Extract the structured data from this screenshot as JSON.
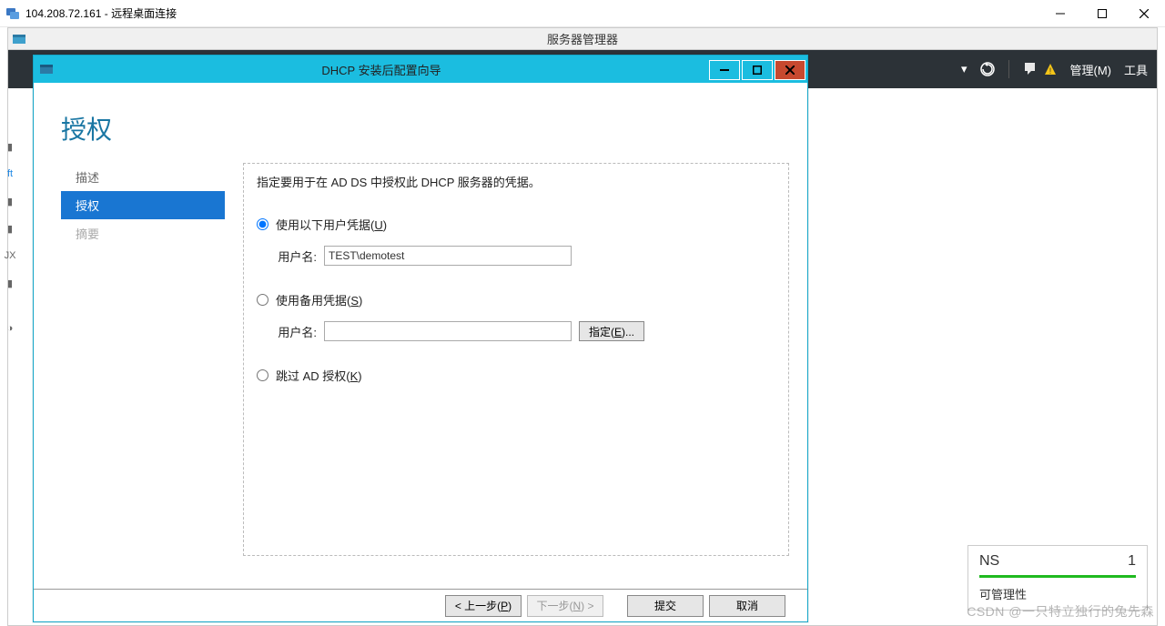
{
  "rdp": {
    "title": "104.208.72.161 - 远程桌面连接"
  },
  "server_manager": {
    "title": "服务器管理器",
    "toolbar": {
      "manage": "管理(M)",
      "tools": "工具"
    },
    "card": {
      "label": "NS",
      "count": "1",
      "manageability": "可管理性"
    }
  },
  "wizard": {
    "title": "DHCP 安装后配置向导",
    "heading": "授权",
    "nav": {
      "description": "描述",
      "authorize": "授权",
      "summary": "摘要"
    },
    "desc": "指定要用于在 AD DS 中授权此 DHCP 服务器的凭据。",
    "opt1": {
      "label": "使用以下用户凭据(U)",
      "username_label": "用户名:",
      "username_value": "TEST\\demotest"
    },
    "opt2": {
      "label": "使用备用凭据(S)",
      "username_label": "用户名:",
      "specify_btn": "指定(E)..."
    },
    "opt3": {
      "label": "跳过 AD 授权(K)"
    },
    "footer": {
      "prev": "< 上一步(P)",
      "next": "下一步(N) >",
      "commit": "提交",
      "cancel": "取消"
    }
  },
  "watermark": "CSDN @一只特立独行的兔先森"
}
